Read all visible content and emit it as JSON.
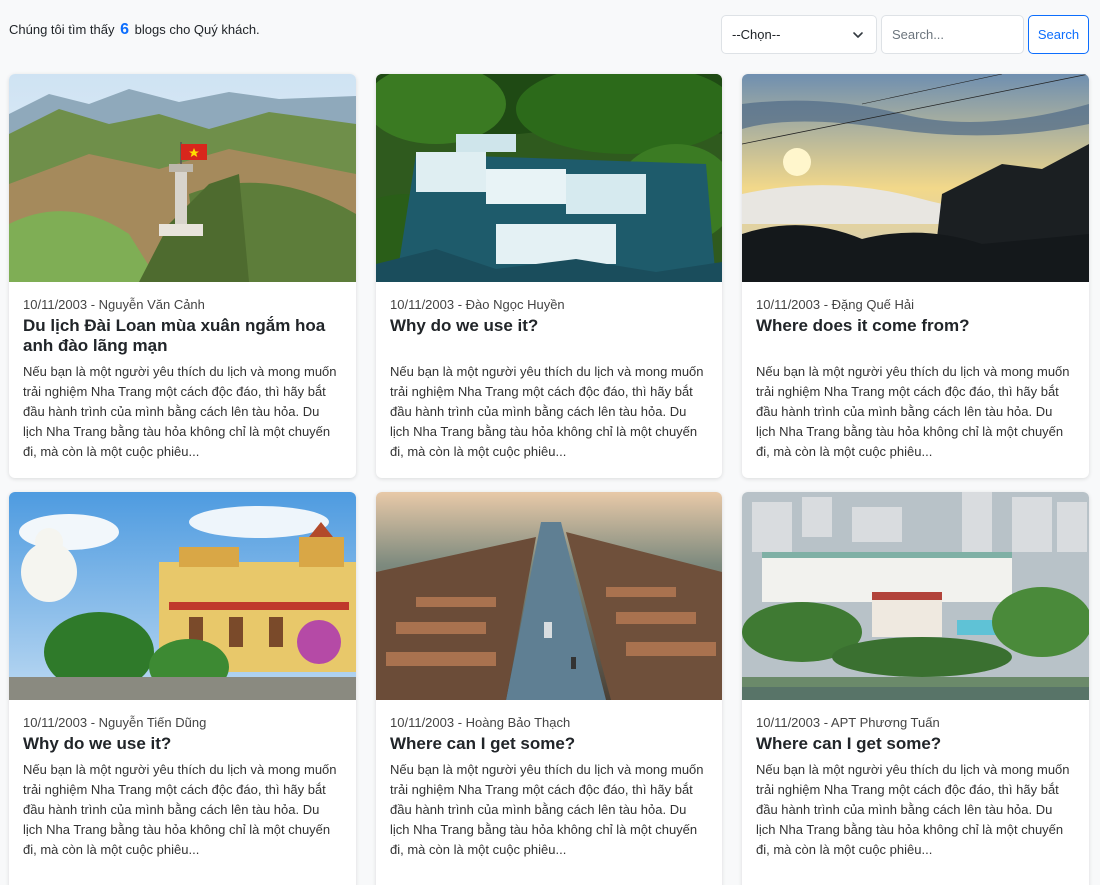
{
  "header": {
    "result_prefix": "Chúng tôi tìm thấy",
    "result_count": "6",
    "result_suffix": "blogs cho Quý khách."
  },
  "filter": {
    "selected": "--Chọn--"
  },
  "search": {
    "placeholder": "Search...",
    "button_label": "Search"
  },
  "posts": [
    {
      "date_author": "10/11/2003 - Nguyễn Văn Cảnh",
      "title": "Du lịch Đài Loan mùa xuân ngắm hoa anh đào lãng mạn",
      "excerpt": "Nếu bạn là một người yêu thích du lịch và mong muốn trải nghiệm Nha Trang một cách độc đáo, thì hãy bắt đầu hành trình của mình bằng cách lên tàu hỏa. Du lịch Nha Trang bằng tàu hỏa không chỉ là một chuyến đi, mà còn là một cuộc phiêu..."
    },
    {
      "date_author": "10/11/2003 - Đào Ngọc Huyền",
      "title": "Why do we use it?",
      "excerpt": "Nếu bạn là một người yêu thích du lịch và mong muốn trải nghiệm Nha Trang một cách độc đáo, thì hãy bắt đầu hành trình của mình bằng cách lên tàu hỏa. Du lịch Nha Trang bằng tàu hỏa không chỉ là một chuyến đi, mà còn là một cuộc phiêu..."
    },
    {
      "date_author": "10/11/2003 - Đặng Quế Hải",
      "title": "Where does it come from?",
      "excerpt": "Nếu bạn là một người yêu thích du lịch và mong muốn trải nghiệm Nha Trang một cách độc đáo, thì hãy bắt đầu hành trình của mình bằng cách lên tàu hỏa. Du lịch Nha Trang bằng tàu hỏa không chỉ là một chuyến đi, mà còn là một cuộc phiêu..."
    },
    {
      "date_author": "10/11/2003 - Nguyễn Tiến Dũng",
      "title": "Why do we use it?",
      "excerpt": "Nếu bạn là một người yêu thích du lịch và mong muốn trải nghiệm Nha Trang một cách độc đáo, thì hãy bắt đầu hành trình của mình bằng cách lên tàu hỏa. Du lịch Nha Trang bằng tàu hỏa không chỉ là một chuyến đi, mà còn là một cuộc phiêu..."
    },
    {
      "date_author": "10/11/2003 - Hoàng Bảo Thạch",
      "title": "Where can I get some?",
      "excerpt": "Nếu bạn là một người yêu thích du lịch và mong muốn trải nghiệm Nha Trang một cách độc đáo, thì hãy bắt đầu hành trình của mình bằng cách lên tàu hỏa. Du lịch Nha Trang bằng tàu hỏa không chỉ là một chuyến đi, mà còn là một cuộc phiêu..."
    },
    {
      "date_author": "10/11/2003 - APT Phương Tuấn",
      "title": "Where can I get some?",
      "excerpt": "Nếu bạn là một người yêu thích du lịch và mong muốn trải nghiệm Nha Trang một cách độc đáo, thì hãy bắt đầu hành trình của mình bằng cách lên tàu hỏa. Du lịch Nha Trang bằng tàu hỏa không chỉ là một chuyến đi, mà còn là một cuộc phiêu..."
    }
  ]
}
